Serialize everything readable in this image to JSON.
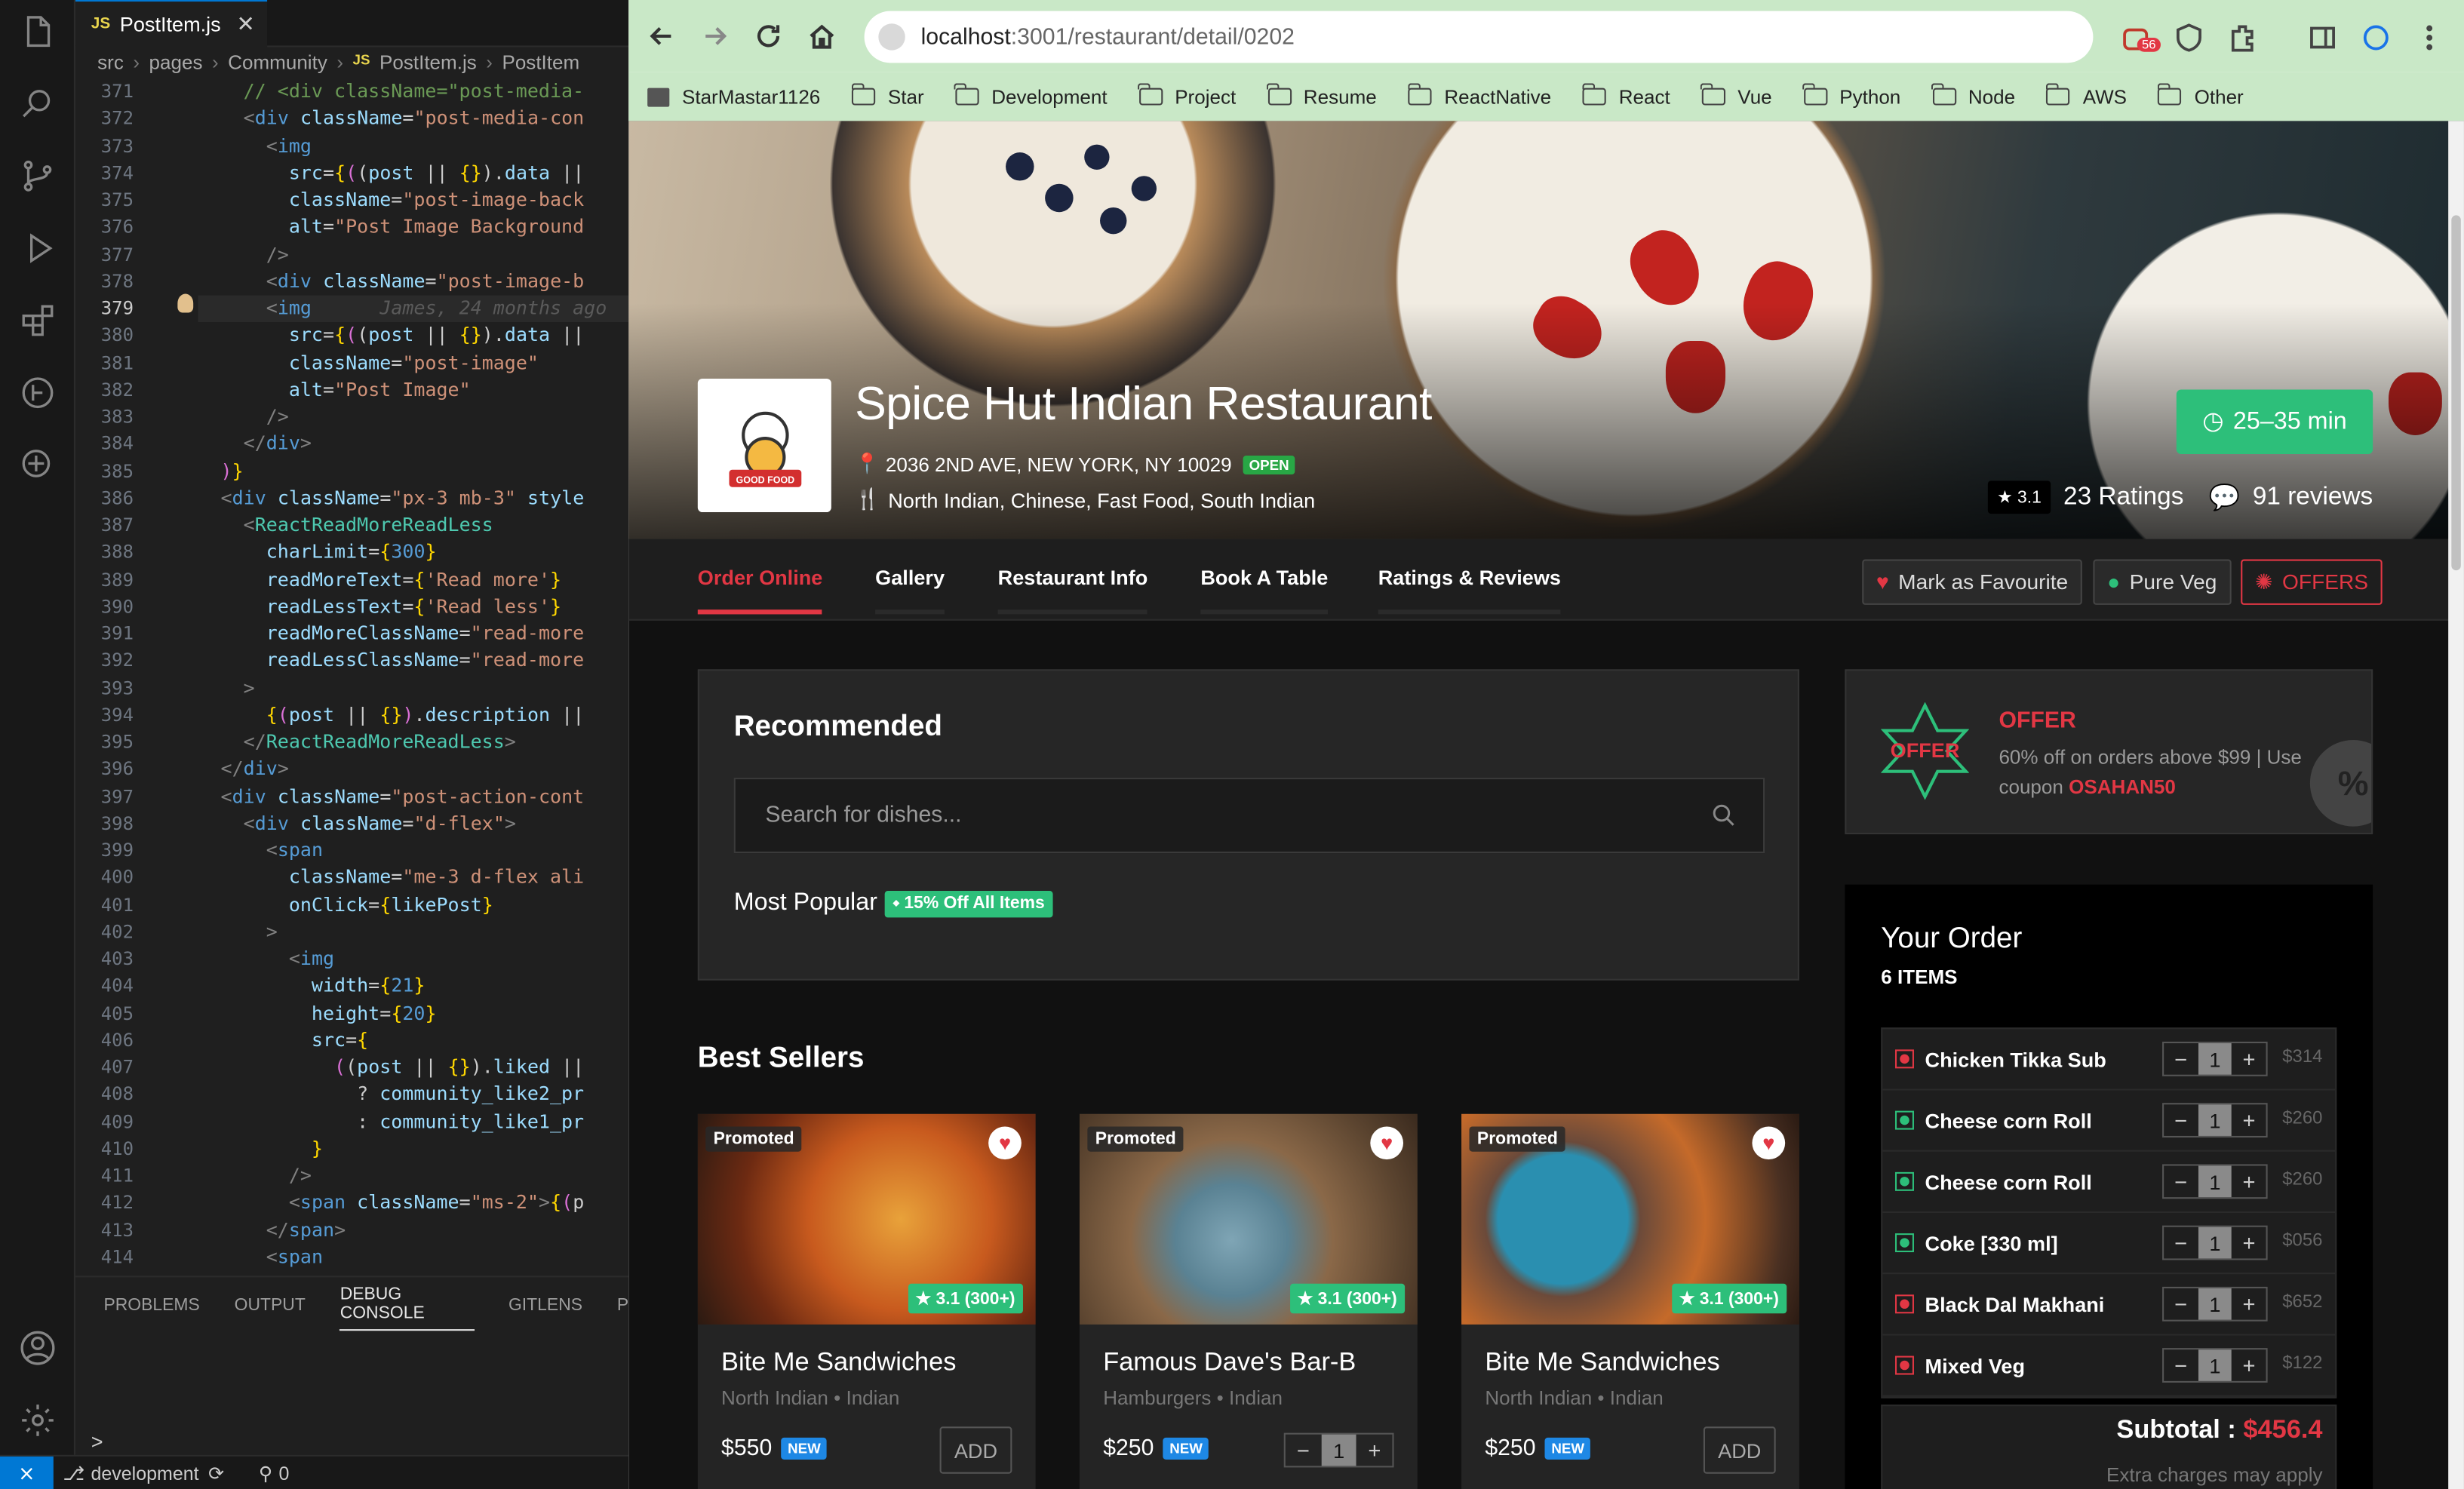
{
  "vscode": {
    "tab_title": "PostItem.js",
    "tab_icon": "JS",
    "breadcrumb": [
      "src",
      "pages",
      "Community",
      "PostItem.js",
      "PostItem"
    ],
    "line_numbers": [
      "371",
      "372",
      "373",
      "374",
      "375",
      "376",
      "377",
      "378",
      "379",
      "380",
      "381",
      "382",
      "383",
      "384",
      "385",
      "386",
      "387",
      "388",
      "389",
      "390",
      "391",
      "392",
      "393",
      "394",
      "395",
      "396",
      "397",
      "398",
      "399",
      "400",
      "401",
      "402",
      "403",
      "404",
      "405",
      "406",
      "407",
      "408",
      "409",
      "410",
      "411",
      "412",
      "413",
      "414"
    ],
    "current_line": "379",
    "blame": "James, 24 months ago",
    "panel_tabs": [
      "PROBLEMS",
      "OUTPUT",
      "DEBUG CONSOLE",
      "GITLENS",
      "P"
    ],
    "terminal_prompt": ">",
    "status": {
      "branch": "development",
      "ports": "0"
    }
  },
  "browser": {
    "url_host": "localhost",
    "url_rest": ":3001/restaurant/detail/0202",
    "ext_badge": "56",
    "bookmarks": [
      "StarMastar1126",
      "Star",
      "Development",
      "Project",
      "Resume",
      "ReactNative",
      "React",
      "Vue",
      "Python",
      "Node",
      "AWS",
      "Other"
    ]
  },
  "restaurant": {
    "logo_text": "GOOD FOOD",
    "name": "Spice Hut Indian Restaurant",
    "address": "2036 2ND AVE, NEW YORK, NY 10029",
    "open_label": "OPEN",
    "cuisines": "North Indian, Chinese, Fast Food, South Indian",
    "delivery_time": "25–35 min",
    "rating": "3.1",
    "ratings_count": "23 Ratings",
    "reviews_count": "91 reviews"
  },
  "tabs": [
    "Order Online",
    "Gallery",
    "Restaurant Info",
    "Book A Table",
    "Ratings & Reviews"
  ],
  "actions": {
    "favourite": "Mark as Favourite",
    "veg": "Pure Veg",
    "offers": "OFFERS"
  },
  "recommended": {
    "title": "Recommended",
    "search_placeholder": "Search for dishes...",
    "most_popular": "Most Popular",
    "discount": "15% Off All Items"
  },
  "best_sellers": {
    "title": "Best Sellers",
    "items": [
      {
        "promo": "Promoted",
        "rating": "3.1 (300+)",
        "name": "Bite Me Sandwiches",
        "tags": "North Indian • Indian",
        "price": "$550",
        "badge": "NEW",
        "action": "ADD"
      },
      {
        "promo": "Promoted",
        "rating": "3.1 (300+)",
        "name": "Famous Dave's Bar-B",
        "tags": "Hamburgers • Indian",
        "price": "$250",
        "badge": "NEW",
        "qty": "1"
      },
      {
        "promo": "Promoted",
        "rating": "3.1 (300+)",
        "name": "Bite Me Sandwiches",
        "tags": "North Indian • Indian",
        "price": "$250",
        "badge": "NEW",
        "action": "ADD"
      }
    ]
  },
  "offer": {
    "badge": "OFFER",
    "title": "OFFER",
    "text": "60% off on orders above $99 | Use coupon ",
    "code": "OSAHAN50"
  },
  "order": {
    "title": "Your Order",
    "count": "6 ITEMS",
    "items": [
      {
        "name": "Chicken Tikka Sub",
        "qty": "1",
        "price": "$314",
        "veg": false
      },
      {
        "name": "Cheese corn Roll",
        "qty": "1",
        "price": "$260",
        "veg": true
      },
      {
        "name": "Cheese corn Roll",
        "qty": "1",
        "price": "$260",
        "veg": true
      },
      {
        "name": "Coke [330 ml]",
        "qty": "1",
        "price": "$056",
        "veg": true
      },
      {
        "name": "Black Dal Makhani",
        "qty": "1",
        "price": "$652",
        "veg": false
      },
      {
        "name": "Mixed Veg",
        "qty": "1",
        "price": "$122",
        "veg": false
      }
    ],
    "subtotal_label": "Subtotal : ",
    "subtotal": "$456.4",
    "extra": "Extra charges may apply"
  }
}
